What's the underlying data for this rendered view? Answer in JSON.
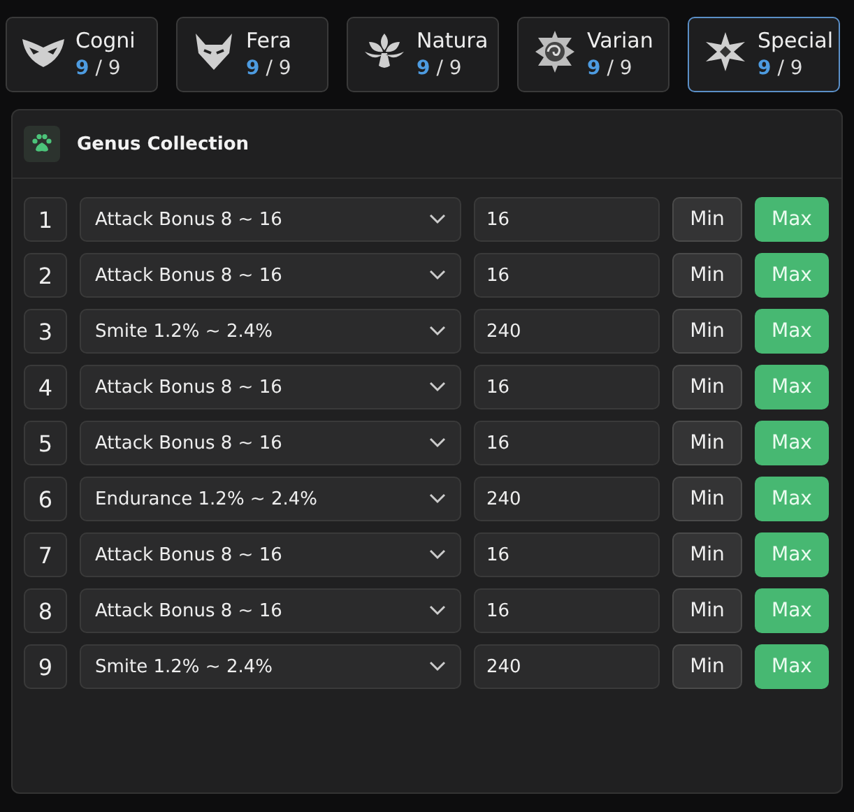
{
  "categories": [
    {
      "name": "Cogni",
      "count": "9",
      "total": "/ 9",
      "selected": false
    },
    {
      "name": "Fera",
      "count": "9",
      "total": "/ 9",
      "selected": false
    },
    {
      "name": "Natura",
      "count": "9",
      "total": "/ 9",
      "selected": false
    },
    {
      "name": "Varian",
      "count": "9",
      "total": "/ 9",
      "selected": false
    },
    {
      "name": "Special",
      "count": "9",
      "total": "/ 9",
      "selected": true
    }
  ],
  "panel": {
    "title": "Genus Collection",
    "rows": [
      {
        "index": "1",
        "stat": "Attack Bonus 8 ~ 16",
        "value": "16",
        "min_label": "Min",
        "max_label": "Max"
      },
      {
        "index": "2",
        "stat": "Attack Bonus 8 ~ 16",
        "value": "16",
        "min_label": "Min",
        "max_label": "Max"
      },
      {
        "index": "3",
        "stat": "Smite 1.2% ~ 2.4%",
        "value": "240",
        "min_label": "Min",
        "max_label": "Max"
      },
      {
        "index": "4",
        "stat": "Attack Bonus 8 ~ 16",
        "value": "16",
        "min_label": "Min",
        "max_label": "Max"
      },
      {
        "index": "5",
        "stat": "Attack Bonus 8 ~ 16",
        "value": "16",
        "min_label": "Min",
        "max_label": "Max"
      },
      {
        "index": "6",
        "stat": "Endurance 1.2% ~ 2.4%",
        "value": "240",
        "min_label": "Min",
        "max_label": "Max"
      },
      {
        "index": "7",
        "stat": "Attack Bonus 8 ~ 16",
        "value": "16",
        "min_label": "Min",
        "max_label": "Max"
      },
      {
        "index": "8",
        "stat": "Attack Bonus 8 ~ 16",
        "value": "16",
        "min_label": "Min",
        "max_label": "Max"
      },
      {
        "index": "9",
        "stat": "Smite 1.2% ~ 2.4%",
        "value": "240",
        "min_label": "Min",
        "max_label": "Max"
      }
    ]
  }
}
